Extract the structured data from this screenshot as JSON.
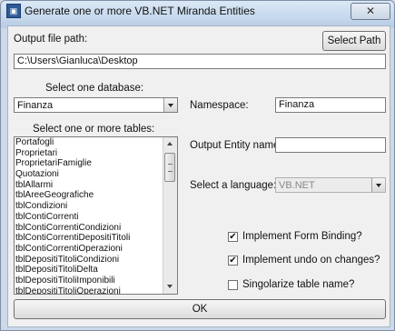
{
  "window": {
    "title": "Generate one or more VB.NET Miranda Entities",
    "close_label": "✕"
  },
  "output": {
    "label": "Output file path:",
    "value": "C:\\Users\\Gianluca\\Desktop",
    "button": "Select Path"
  },
  "database": {
    "label": "Select one database:",
    "selected": "Finanza"
  },
  "tables": {
    "label": "Select one or more tables:",
    "items": [
      "Portafogli",
      "Proprietari",
      "ProprietariFamiglie",
      "Quotazioni",
      "tblAllarmi",
      "tblAreeGeografiche",
      "tblCondizioni",
      "tblContiCorrenti",
      "tblContiCorrentiCondizioni",
      "tblContiCorrentiDepositiTitoli",
      "tblContiCorrentiOperazioni",
      "tblDepositiTitoliCondizioni",
      "tblDepositiTitoliDelta",
      "tblDepositiTitoliImponibili",
      "tblDepositiTitoliOperazioni"
    ]
  },
  "namespace": {
    "label": "Namespace:",
    "value": "Finanza"
  },
  "entity": {
    "label": "Output Entity name:",
    "value": ""
  },
  "language": {
    "label": "Select a language:",
    "selected": "VB.NET"
  },
  "options": [
    {
      "label": "Implement Form Binding?",
      "checked": true,
      "mark": "✔"
    },
    {
      "label": "Implement undo on changes?",
      "checked": true,
      "mark": "✔"
    },
    {
      "label": "Singolarize table name?",
      "checked": false,
      "mark": ""
    }
  ],
  "ok_button": "OK"
}
